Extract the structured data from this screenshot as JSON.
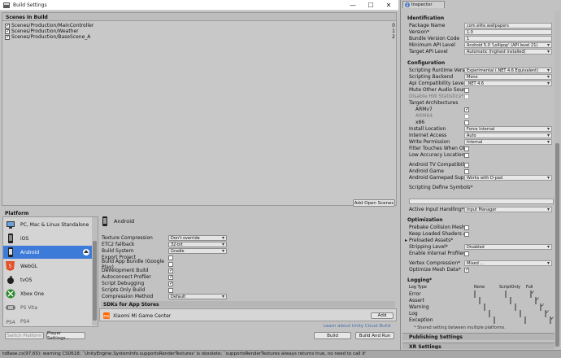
{
  "window": {
    "title": "Build Settings",
    "min_glyph": "—",
    "max_glyph": "☐",
    "close_glyph": "✕"
  },
  "scenes": {
    "header": "Scenes In Build",
    "items": [
      {
        "path": "Scenes/Production/MainController",
        "index": "0"
      },
      {
        "path": "Scenes/Production/Weather",
        "index": "1"
      },
      {
        "path": "Scenes/Production/BaseScene_A",
        "index": "2"
      }
    ],
    "add_open_scenes": "Add Open Scenes"
  },
  "platform": {
    "label": "Platform",
    "items": [
      {
        "name": "PC, Mac & Linux Standalone",
        "icon": "monitor-icon"
      },
      {
        "name": "iOS",
        "icon": "ios-icon"
      },
      {
        "name": "Android",
        "icon": "android-icon",
        "selected": true
      },
      {
        "name": "WebGL",
        "icon": "html5-icon"
      },
      {
        "name": "tvOS",
        "icon": "apple-tv-icon"
      },
      {
        "name": "Xbox One",
        "icon": "xbox-icon"
      },
      {
        "name": "PS Vita",
        "icon": "ps-vita-icon"
      },
      {
        "name": "PS4",
        "icon": "ps4-icon"
      }
    ]
  },
  "android_settings": {
    "title": "Android",
    "texture_compression": {
      "label": "Texture Compression",
      "value": "Don't override"
    },
    "etc2_fallback": {
      "label": "ETC2 fallback",
      "value": "32-bit"
    },
    "build_system": {
      "label": "Build System",
      "value": "Gradle"
    },
    "export_project": {
      "label": "Export Project"
    },
    "build_app_bundle": {
      "label": "Build App Bundle (Google Play)"
    },
    "development_build": {
      "label": "Development Build"
    },
    "autoconnect_profiler": {
      "label": "Autoconnect Profiler"
    },
    "script_debugging": {
      "label": "Script Debugging"
    },
    "scripts_only_build": {
      "label": "Scripts Only Build"
    },
    "compression_method": {
      "label": "Compression Method",
      "value": "Default"
    }
  },
  "sdks": {
    "header": "SDKs for App Stores",
    "items": [
      {
        "name": "Xiaomi Mi Game Center"
      }
    ],
    "add_label": "Add",
    "learn_link": "Learn about Unity Cloud Build"
  },
  "buttons": {
    "switch_platform": "Switch Platform",
    "player_settings": "Player Settings...",
    "build": "Build",
    "build_and_run": "Build And Run"
  },
  "inspector": {
    "tab": "Inspector",
    "identification": {
      "title": "Identification",
      "package_name": {
        "label": "Package Name",
        "value": "com.elite.wallpapers"
      },
      "version": {
        "label": "Version*",
        "value": "1.0"
      },
      "bundle_version_code": {
        "label": "Bundle Version Code",
        "value": "1"
      },
      "min_api": {
        "label": "Minimum API Level",
        "value": "Android 5.0 'Lollipop' (API level 21)"
      },
      "target_api": {
        "label": "Target API Level",
        "value": "Automatic (highest installed)"
      }
    },
    "configuration": {
      "title": "Configuration",
      "scripting_runtime": {
        "label": "Scripting Runtime Version",
        "value": "Experimental (.NET 4.6 Equivalent)"
      },
      "scripting_backend": {
        "label": "Scripting Backend",
        "value": "Mono"
      },
      "api_compat": {
        "label": "Api Compatibility Level*",
        "value": ".NET 4.6"
      },
      "mute_other_audio": {
        "label": "Mute Other Audio Sources"
      },
      "disable_hw_stats": {
        "label": "Disable HW Statistics*"
      },
      "target_architectures": {
        "label": "Target Architectures"
      },
      "armv7": {
        "label": "ARMv7"
      },
      "arm64": {
        "label": "ARM64"
      },
      "x86": {
        "label": "x86"
      },
      "install_location": {
        "label": "Install Location",
        "value": "Force Internal"
      },
      "internet_access": {
        "label": "Internet Access",
        "value": "Auto"
      },
      "write_permission": {
        "label": "Write Permission",
        "value": "Internal"
      },
      "filter_touches": {
        "label": "Filter Touches When Obscured"
      },
      "low_accuracy_location": {
        "label": "Low Accuracy Location"
      },
      "android_tv": {
        "label": "Android TV Compatibility"
      },
      "android_game": {
        "label": "Android Game"
      },
      "android_gamepad": {
        "label": "Android Gamepad Support Level",
        "value": "Works with D-pad"
      },
      "define_symbols": {
        "label": "Scripting Define Symbols*"
      },
      "active_input": {
        "label": "Active Input Handling*",
        "value": "Input Manager"
      }
    },
    "optimization": {
      "title": "Optimization",
      "prebake": {
        "label": "Prebake Collision Meshes*"
      },
      "keep_shaders": {
        "label": "Keep Loaded Shaders Alive*"
      },
      "preloaded_assets": {
        "label": "Preloaded Assets*"
      },
      "stripping": {
        "label": "Stripping Level*",
        "value": "Disabled"
      },
      "internal_profiler": {
        "label": "Enable Internal Profiler*"
      },
      "vertex_compression": {
        "label": "Vertex Compression*",
        "value": "Mixed ..."
      },
      "optimize_mesh": {
        "label": "Optimize Mesh Data*"
      }
    },
    "logging": {
      "title": "Logging*",
      "col_type": "Log Type",
      "col_none": "None",
      "col_script": "ScriptOnly",
      "col_full": "Full",
      "rows": [
        "Error",
        "Assert",
        "Warning",
        "Log",
        "Exception"
      ],
      "note": "* Shared setting between multiple platforms."
    },
    "publishing": "Publishing Settings",
    "xr": "XR Settings"
  },
  "status": {
    "message": "tsBase.cs(97,65): warning CS0618: `UnityEngine.SystemInfo.supportsRenderTextures' is obsolete: `supportsRenderTextures always returns true, no need to call it'"
  }
}
